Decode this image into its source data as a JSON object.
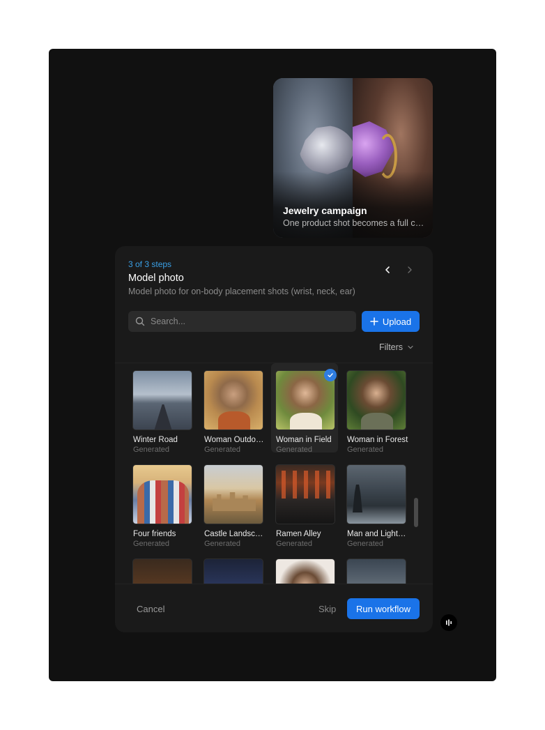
{
  "hero": {
    "title": "Jewelry campaign",
    "subtitle": "One product shot becomes a full campaign"
  },
  "panel": {
    "step_count": "3 of 3 steps",
    "title": "Model photo",
    "description": "Model photo for on-body placement shots (wrist, neck, ear)",
    "search_placeholder": "Search...",
    "upload_label": "Upload",
    "filters_label": "Filters"
  },
  "grid": {
    "items": [
      {
        "name": "Winter Road",
        "source": "Generated",
        "selected": false
      },
      {
        "name": "Woman Outdoors",
        "source": "Generated",
        "selected": false
      },
      {
        "name": "Woman in Field",
        "source": "Generated",
        "selected": true
      },
      {
        "name": "Woman in Forest",
        "source": "Generated",
        "selected": false
      },
      {
        "name": "Four friends",
        "source": "Generated",
        "selected": false
      },
      {
        "name": "Castle Landscape",
        "source": "Generated",
        "selected": false
      },
      {
        "name": "Ramen Alley",
        "source": "Generated",
        "selected": false
      },
      {
        "name": "Man and Lighthouse",
        "source": "Generated",
        "selected": false
      }
    ]
  },
  "footer": {
    "cancel_label": "Cancel",
    "skip_label": "Skip",
    "run_label": "Run workflow"
  },
  "colors": {
    "accent": "#1a73e8",
    "step_text": "#3aa0e6",
    "panel_bg": "#1a1a1a",
    "stage_bg": "#111111"
  },
  "icons": {
    "search": "search-icon",
    "upload": "plus-icon",
    "filters": "chevron-down-icon",
    "prev": "chevron-left-icon",
    "next": "chevron-right-icon",
    "selected": "check-icon",
    "widget": "audio-bars-icon"
  }
}
